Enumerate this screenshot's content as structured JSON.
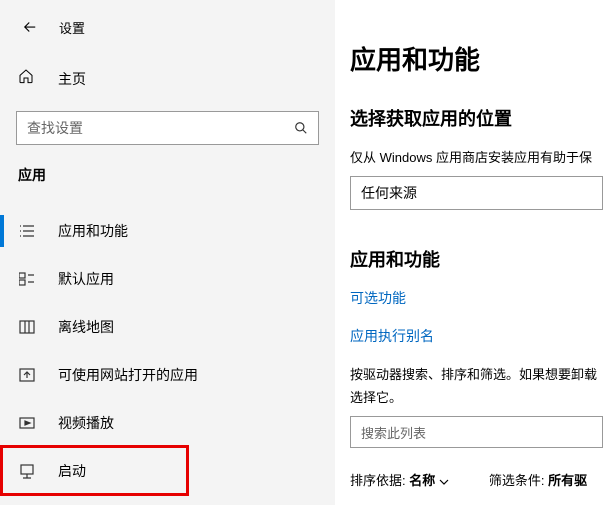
{
  "header": {
    "title": "设置"
  },
  "sidebar": {
    "home_label": "主页",
    "search_placeholder": "查找设置",
    "section_label": "应用",
    "items": [
      {
        "label": "应用和功能"
      },
      {
        "label": "默认应用"
      },
      {
        "label": "离线地图"
      },
      {
        "label": "可使用网站打开的应用"
      },
      {
        "label": "视频播放"
      },
      {
        "label": "启动"
      }
    ]
  },
  "main": {
    "heading": "应用和功能",
    "source_heading": "选择获取应用的位置",
    "source_desc": "仅从 Windows 应用商店安装应用有助于保",
    "source_value": "任何来源",
    "section2_heading": "应用和功能",
    "optional_link": "可选功能",
    "alias_link": "应用执行别名",
    "filter_desc": "按驱动器搜索、排序和筛选。如果想要卸载",
    "filter_desc2": "选择它。",
    "search_list_placeholder": "搜索此列表",
    "sort_label": "排序依据:",
    "sort_value": "名称",
    "filter_label": "筛选条件:",
    "filter_value": "所有驱"
  }
}
